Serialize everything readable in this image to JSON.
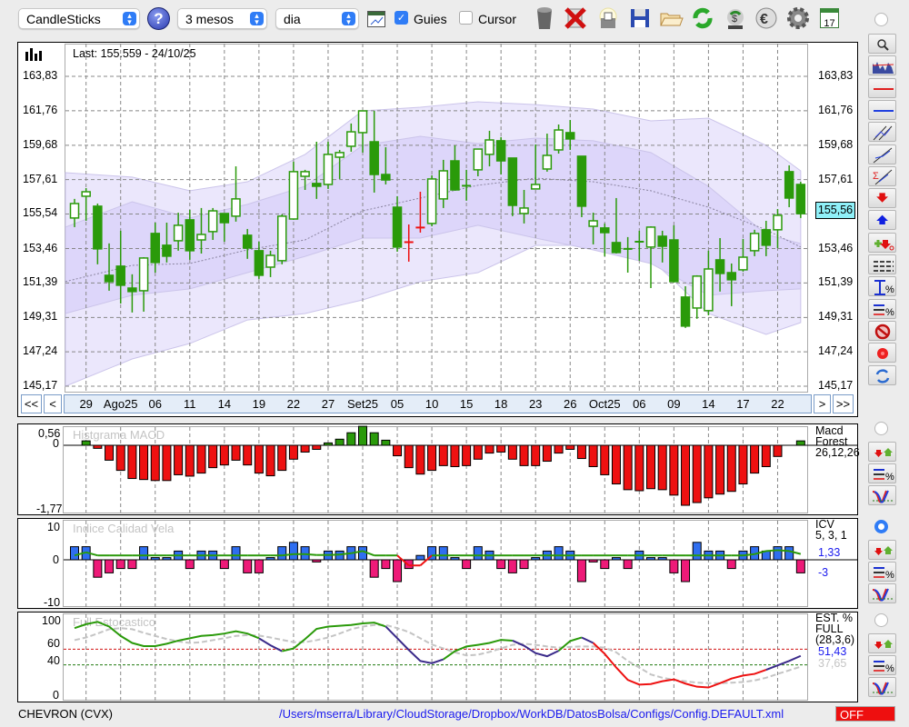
{
  "toolbar": {
    "chart_type": "CandleSticks",
    "period": "3 mesos",
    "interval": "dia",
    "guides_label": "Guies",
    "guides_checked": true,
    "cursor_label": "Cursor",
    "cursor_checked": false,
    "calendar_day": "17"
  },
  "main": {
    "last": "Last: 155.559 - 24/10/25",
    "y_ticks": [
      "163,83",
      "161,76",
      "159,68",
      "157,61",
      "155,54",
      "153,46",
      "151,39",
      "149,31",
      "147,24",
      "145,17"
    ],
    "last_price_label": "155,56",
    "x_labels": [
      "29",
      "Ago25",
      "06",
      "11",
      "14",
      "19",
      "22",
      "27",
      "Set25",
      "05",
      "10",
      "15",
      "18",
      "23",
      "26",
      "Oct25",
      "06",
      "09",
      "14",
      "17",
      "22"
    ],
    "nav": {
      "first": "<<",
      "prev": "<",
      "next": ">",
      "last": ">>"
    }
  },
  "macd": {
    "title": "Histgrama MACD",
    "y_top": "0,56",
    "y_zero": "0",
    "y_bottom": "-1,77",
    "legend": [
      "Macd",
      "Forest",
      "26,12,26"
    ]
  },
  "icv": {
    "title": "Indice Calidad Vela",
    "y_top": "10",
    "y_zero": "0",
    "y_bottom": "-10",
    "legend": [
      "ICV",
      "5, 3, 1"
    ],
    "value1": "1,33",
    "value2": "-3"
  },
  "stoch": {
    "title": "Full Estocastico",
    "y_100": "100",
    "y_60": "60",
    "y_40": "40",
    "y_0": "0",
    "legend": [
      "EST. %",
      "FULL",
      "(28,3,6)"
    ],
    "k_value": "51,43",
    "d_value": "37,65"
  },
  "footer": {
    "symbol": "CHEVRON (CVX)",
    "path": "/Users/mserra/Library/CloudStorage/Dropbox/WorkDB/DatosBolsa/Configs/Config.DEFAULT.xml",
    "status": "OFF"
  },
  "colors": {
    "bull": "#2a9a0a",
    "red": "#ee1111",
    "icv_pos": "#2f6ef0",
    "icv_neg": "#ee1a78",
    "k_green": "#2a9a0a",
    "k_purple": "#3a2a8a",
    "k_red": "#ee1111",
    "d_line": "#c4c4c4",
    "band_outer": "#ebe7fc",
    "band_inner": "#ddd6fa",
    "price_label_bg": "#8ff0f8"
  },
  "chart_data": [
    {
      "type": "candlestick",
      "name": "price",
      "ylim": [
        145.17,
        163.83
      ],
      "candles": [
        [
          155.3,
          156.45,
          154.75,
          156.17
        ],
        [
          156.61,
          157.1,
          155.13,
          156.88
        ],
        [
          156.01,
          156.17,
          152.51,
          153.44
        ],
        [
          151.85,
          153.77,
          150.92,
          151.47
        ],
        [
          152.4,
          154.53,
          150.15,
          151.25
        ],
        [
          151.08,
          151.91,
          149.61,
          150.87
        ],
        [
          150.92,
          152.94,
          149.66,
          152.89
        ],
        [
          154.37,
          155.02,
          152.01,
          152.62
        ],
        [
          153.66,
          155.02,
          152.62,
          153.0
        ],
        [
          153.93,
          155.62,
          153.33,
          154.86
        ],
        [
          155.19,
          155.79,
          152.78,
          153.33
        ],
        [
          153.98,
          155.9,
          153.16,
          154.31
        ],
        [
          154.48,
          155.9,
          153.98,
          155.73
        ],
        [
          155.57,
          155.57,
          153.87,
          155.02
        ],
        [
          155.41,
          158.41,
          155.08,
          156.45
        ],
        [
          154.26,
          154.64,
          152.84,
          153.49
        ],
        [
          153.33,
          153.87,
          151.63,
          151.85
        ],
        [
          152.34,
          153.33,
          151.74,
          153.05
        ],
        [
          152.73,
          155.52,
          152.51,
          155.41
        ],
        [
          155.24,
          158.69,
          155.19,
          158.09
        ],
        [
          157.81,
          158.2,
          156.99,
          158.09
        ],
        [
          157.38,
          159.89,
          156.45,
          157.21
        ],
        [
          157.32,
          159.89,
          157.05,
          159.13
        ],
        [
          158.96,
          159.4,
          157.65,
          159.24
        ],
        [
          159.62,
          160.99,
          159.29,
          160.49
        ],
        [
          160.44,
          161.75,
          159.24,
          161.75
        ],
        [
          159.89,
          161.75,
          156.83,
          157.92
        ],
        [
          157.92,
          159.56,
          157.32,
          157.59
        ],
        [
          155.95,
          156.61,
          153.27,
          153.55
        ],
        [
          153.87,
          154.91,
          152.67,
          153.82
        ],
        [
          154.75,
          156.88,
          154.42,
          154.7
        ],
        [
          154.97,
          157.87,
          154.8,
          157.65
        ],
        [
          156.45,
          158.8,
          155.9,
          158.14
        ],
        [
          158.74,
          159.67,
          156.94,
          156.99
        ],
        [
          157.27,
          158.2,
          156.34,
          157.21
        ],
        [
          158.2,
          159.45,
          157.81,
          159.45
        ],
        [
          159.13,
          160.55,
          158.41,
          160.0
        ],
        [
          159.95,
          160.17,
          157.92,
          158.74
        ],
        [
          158.91,
          158.91,
          155.41,
          156.06
        ],
        [
          155.57,
          156.99,
          154.97,
          155.9
        ],
        [
          157.05,
          159.73,
          157.05,
          157.32
        ],
        [
          158.25,
          160.38,
          158.09,
          159.07
        ],
        [
          159.4,
          160.93,
          159.18,
          160.6
        ],
        [
          160.44,
          161.2,
          159.4,
          160.06
        ],
        [
          159.02,
          159.02,
          155.35,
          156.01
        ],
        [
          154.8,
          155.62,
          153.71,
          155.13
        ],
        [
          154.7,
          154.97,
          153.0,
          154.42
        ],
        [
          153.82,
          156.5,
          153.16,
          153.22
        ],
        [
          153.44,
          154.15,
          152.01,
          153.44
        ],
        [
          153.87,
          154.53,
          152.73,
          153.87
        ],
        [
          153.55,
          154.8,
          151.08,
          154.75
        ],
        [
          154.2,
          154.53,
          152.62,
          153.6
        ],
        [
          153.98,
          154.86,
          151.41,
          151.47
        ],
        [
          150.54,
          151.19,
          148.68,
          148.79
        ],
        [
          149.88,
          151.85,
          149.23,
          151.8
        ],
        [
          149.72,
          153.33,
          149.44,
          152.23
        ],
        [
          152.78,
          154.09,
          150.87,
          151.96
        ],
        [
          152.01,
          152.56,
          149.99,
          151.58
        ],
        [
          152.18,
          154.04,
          152.07,
          152.94
        ],
        [
          153.33,
          154.59,
          153.0,
          154.37
        ],
        [
          154.59,
          155.13,
          153.0,
          153.66
        ],
        [
          154.59,
          155.84,
          153.49,
          155.46
        ],
        [
          158.09,
          158.47,
          155.95,
          156.5
        ],
        [
          157.32,
          157.48,
          155.3,
          155.56
        ]
      ],
      "red_candles": [
        29,
        30
      ],
      "bands": {
        "index": [
          0,
          5,
          10,
          15,
          20,
          25,
          30,
          35,
          40,
          45,
          50,
          55,
          60,
          63
        ],
        "outer_upper": [
          158.03,
          157.76,
          156.94,
          157.48,
          159.13,
          161.75,
          161.97,
          162.3,
          162.13,
          161.86,
          161.15,
          161.31,
          159.67,
          158.14
        ],
        "inner_upper": [
          154.75,
          156.28,
          155.3,
          156.12,
          157.21,
          159.67,
          160.22,
          159.78,
          160.11,
          159.95,
          159.24,
          157.21,
          154.31,
          153.76
        ],
        "middle": [
          151.47,
          152.45,
          152.56,
          153.38,
          153.98,
          155.73,
          156.5,
          157.27,
          157.7,
          157.48,
          156.94,
          155.95,
          154.59,
          153.55
        ],
        "inner_lower": [
          149.55,
          150.65,
          151.03,
          152.01,
          152.99,
          154.09,
          154.09,
          154.86,
          154.09,
          153.38,
          152.56,
          150.65,
          150.92,
          151.03
        ],
        "outer_lower": [
          145.17,
          146.81,
          147.74,
          149.16,
          149.55,
          150.37,
          151.47,
          152.01,
          153.65,
          153.65,
          152.83,
          149.55,
          148.29,
          149.0
        ]
      },
      "x_label_start_index": 1,
      "x_label_step": 3
    },
    {
      "type": "bar",
      "name": "macd_histogram",
      "ylim": [
        -1.77,
        0.56
      ],
      "values": [
        0,
        0.13,
        -0.09,
        -0.44,
        -0.74,
        -0.98,
        -1.01,
        -1.04,
        -1.04,
        -0.87,
        -0.91,
        -0.82,
        -0.66,
        -0.58,
        -0.44,
        -0.58,
        -0.82,
        -0.9,
        -0.74,
        -0.41,
        -0.2,
        -0.12,
        0.07,
        0.18,
        0.37,
        0.56,
        0.37,
        0.15,
        -0.31,
        -0.66,
        -0.85,
        -0.74,
        -0.6,
        -0.63,
        -0.6,
        -0.41,
        -0.23,
        -0.2,
        -0.41,
        -0.6,
        -0.6,
        -0.47,
        -0.23,
        -0.12,
        -0.39,
        -0.63,
        -0.87,
        -1.14,
        -1.31,
        -1.34,
        -1.28,
        -1.31,
        -1.47,
        -1.77,
        -1.69,
        -1.55,
        -1.44,
        -1.36,
        -1.14,
        -0.82,
        -0.63,
        -0.33,
        0,
        0.13
      ]
    },
    {
      "type": "bar",
      "name": "icv",
      "ylim": [
        -10,
        10
      ],
      "values": [
        3,
        3,
        -4,
        -3,
        -2,
        -2,
        3,
        0.5,
        0.5,
        2,
        -2,
        2,
        2,
        -2,
        3,
        -3,
        -3,
        0.5,
        3,
        4,
        3,
        -0.5,
        2,
        2,
        3,
        3,
        -4,
        -2,
        -5,
        -2,
        1,
        3,
        3,
        0.5,
        -2,
        3,
        2,
        -2,
        -3,
        -2,
        0.5,
        2,
        3,
        2,
        -5,
        -0.5,
        -2,
        0.5,
        -2,
        2,
        0.5,
        0.5,
        -3,
        -5,
        4,
        2,
        2,
        -2,
        2,
        3,
        2,
        3,
        3,
        -3
      ],
      "signal": [
        1,
        1.7,
        1,
        1,
        1,
        1,
        1,
        1,
        1,
        1,
        1,
        1,
        1,
        1,
        1,
        1,
        1,
        1,
        1,
        1.3,
        1.3,
        1.1,
        1.1,
        1.2,
        1.5,
        2,
        1,
        1,
        1,
        -1.3,
        -1.3,
        1,
        1,
        1,
        1,
        1,
        1,
        1,
        1,
        1,
        1,
        1,
        1,
        1,
        1,
        1,
        1,
        1,
        1,
        1,
        1,
        1,
        1,
        1,
        1,
        1,
        1,
        1,
        1,
        1.3,
        2,
        2.2,
        2,
        1.33
      ]
    },
    {
      "type": "line",
      "name": "full_stochastic",
      "ylim": [
        0,
        100
      ],
      "levels": [
        60,
        40
      ],
      "k": [
        87,
        92,
        95,
        89,
        77,
        68,
        64,
        64,
        67,
        71,
        74,
        77,
        78,
        80,
        83,
        80,
        74,
        65,
        57.5,
        61,
        73,
        86,
        89,
        90,
        91,
        93,
        94,
        89,
        74,
        59,
        45,
        42,
        47,
        57.5,
        63.5,
        65.6,
        68,
        72,
        71,
        64.5,
        55,
        51,
        58,
        70.5,
        75,
        68,
        54,
        36.5,
        20.7,
        14.7,
        15.4,
        19,
        21.4,
        16,
        12,
        11,
        16.5,
        22.5,
        26.3,
        28.4,
        33.7,
        39.3,
        45,
        51.43
      ],
      "k_segments": [
        {
          "from": 0,
          "to": 16,
          "color": "#2a9a0a"
        },
        {
          "from": 17,
          "to": 18,
          "color": "#3a2a8a"
        },
        {
          "from": 19,
          "to": 27,
          "color": "#2a9a0a"
        },
        {
          "from": 28,
          "to": 32,
          "color": "#3a2a8a"
        },
        {
          "from": 33,
          "to": 38,
          "color": "#2a9a0a"
        },
        {
          "from": 39,
          "to": 42,
          "color": "#3a2a8a"
        },
        {
          "from": 43,
          "to": 44,
          "color": "#2a9a0a"
        },
        {
          "from": 45,
          "to": 45,
          "color": "#3a2a8a"
        },
        {
          "from": 46,
          "to": 60,
          "color": "#ee1111"
        },
        {
          "from": 61,
          "to": 63,
          "color": "#3a2a8a"
        }
      ],
      "d": [
        71.6,
        75,
        80,
        85.6,
        87,
        85.6,
        81,
        77,
        73,
        70,
        68,
        69,
        71.6,
        74,
        77,
        78,
        77.5,
        75,
        72,
        69,
        69,
        71.6,
        75,
        80,
        85.6,
        89,
        91,
        91,
        87,
        82,
        74,
        66,
        61,
        56,
        52,
        53,
        56.5,
        61,
        65.6,
        67,
        65.6,
        63.5,
        62,
        63,
        63.5,
        63.5,
        62,
        56,
        45,
        36.5,
        27.7,
        23.5,
        20.7,
        19,
        17.2,
        16.5,
        16.5,
        17.2,
        18,
        20,
        23.5,
        28.4,
        33,
        37.65
      ]
    }
  ]
}
